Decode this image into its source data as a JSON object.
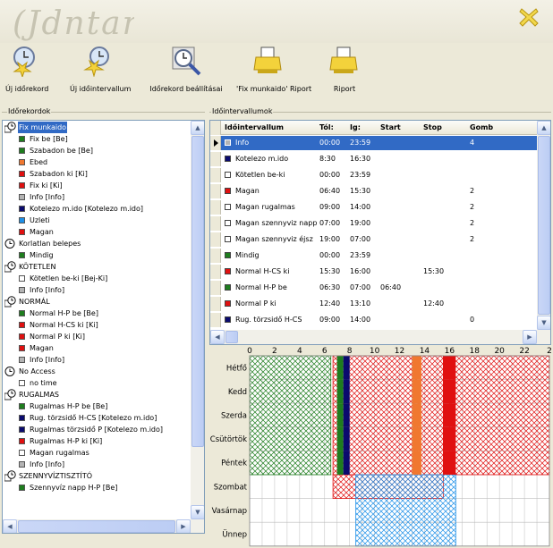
{
  "app": {
    "logo_text": "Idontar"
  },
  "toolbar": [
    {
      "label": "Új időrekord",
      "icon": "clock-star-icon"
    },
    {
      "label": "Új időintervallum",
      "icon": "clock-star-icon"
    },
    {
      "label": "Időrekord beállításai",
      "icon": "clock-magnifier-icon"
    },
    {
      "label": "'Fix munkaido' Riport",
      "icon": "printer-icon"
    },
    {
      "label": "Riport",
      "icon": "printer-icon"
    }
  ],
  "panels": {
    "left_title": "Időrekordok",
    "right_title": "Időintervallumok"
  },
  "colors": {
    "green": "#1e7d1e",
    "red": "#e01010",
    "orange": "#f07830",
    "navy": "#0a0a6e",
    "blue": "#1e90e8",
    "gray": "#b4b4b4",
    "white": "#ffffff",
    "selection": "#316ac5"
  },
  "tree": [
    {
      "type": "group",
      "label": "Fix munkaido",
      "selected": true
    },
    {
      "type": "item",
      "label": "Fix be [Be]",
      "color": "green"
    },
    {
      "type": "item",
      "label": "Szabadon be [Be]",
      "color": "green"
    },
    {
      "type": "item",
      "label": "Ebed",
      "color": "orange"
    },
    {
      "type": "item",
      "label": "Szabadon ki [Ki]",
      "color": "red"
    },
    {
      "type": "item",
      "label": "Fix ki [Ki]",
      "color": "red"
    },
    {
      "type": "item",
      "label": "Info [Info]",
      "color": "gray"
    },
    {
      "type": "item",
      "label": "Kotelezo m.ido [Kotelezo m.ido]",
      "color": "navy"
    },
    {
      "type": "item",
      "label": "Uzleti",
      "color": "blue"
    },
    {
      "type": "item",
      "label": "Magan",
      "color": "red"
    },
    {
      "type": "group2",
      "label": "Korlatlan belepes"
    },
    {
      "type": "item",
      "label": "Mindig",
      "color": "green"
    },
    {
      "type": "group",
      "label": "KÖTETLEN"
    },
    {
      "type": "item",
      "label": "Kötetlen be-ki [Bej-Ki]",
      "color": "white"
    },
    {
      "type": "item",
      "label": "Info [Info]",
      "color": "gray"
    },
    {
      "type": "group",
      "label": "NORMÁL"
    },
    {
      "type": "item",
      "label": "Normal H-P be [Be]",
      "color": "green"
    },
    {
      "type": "item",
      "label": "Normal H-CS ki [Ki]",
      "color": "red"
    },
    {
      "type": "item",
      "label": "Normal P ki [Ki]",
      "color": "red"
    },
    {
      "type": "item",
      "label": "Magan",
      "color": "red"
    },
    {
      "type": "item",
      "label": "Info [Info]",
      "color": "gray"
    },
    {
      "type": "group2",
      "label": "No Access"
    },
    {
      "type": "item",
      "label": "no time",
      "color": "white"
    },
    {
      "type": "group",
      "label": "RUGALMAS"
    },
    {
      "type": "item",
      "label": "Rugalmas H-P be [Be]",
      "color": "green"
    },
    {
      "type": "item",
      "label": "Rug. törzsidő H-CS [Kotelezo m.ido]",
      "color": "navy"
    },
    {
      "type": "item",
      "label": "Rugalmas törzsidő P [Kotelezo m.ido]",
      "color": "navy"
    },
    {
      "type": "item",
      "label": "Rugalmas H-P ki [Ki]",
      "color": "red"
    },
    {
      "type": "item",
      "label": "Magan rugalmas",
      "color": "white"
    },
    {
      "type": "item",
      "label": "Info [Info]",
      "color": "gray"
    },
    {
      "type": "group",
      "label": "SZENNYVÍZTISZTÍTÓ"
    },
    {
      "type": "item",
      "label": "Szennyvíz napp H-P [Be]",
      "color": "green"
    }
  ],
  "grid": {
    "columns": [
      "Időintervallum",
      "Tól:",
      "Ig:",
      "Start",
      "Stop",
      "Gomb"
    ],
    "rows": [
      {
        "name": "Info",
        "color": "gray",
        "from": "00:00",
        "to": "23:59",
        "start": "",
        "stop": "",
        "gomb": "4",
        "selected": true
      },
      {
        "name": "Kotelezo m.ido",
        "color": "navy",
        "from": "8:30",
        "to": "16:30",
        "start": "",
        "stop": "",
        "gomb": ""
      },
      {
        "name": "Kötetlen be-ki",
        "color": "white",
        "from": "00:00",
        "to": "23:59",
        "start": "",
        "stop": "",
        "gomb": ""
      },
      {
        "name": "Magan",
        "color": "red",
        "from": "06:40",
        "to": "15:30",
        "start": "",
        "stop": "",
        "gomb": "2"
      },
      {
        "name": "Magan rugalmas",
        "color": "white",
        "from": "09:00",
        "to": "14:00",
        "start": "",
        "stop": "",
        "gomb": "2"
      },
      {
        "name": "Magan szennyviz napp",
        "color": "white",
        "from": "07:00",
        "to": "19:00",
        "start": "",
        "stop": "",
        "gomb": "2"
      },
      {
        "name": "Magan szennyviz éjsz",
        "color": "white",
        "from": "19:00",
        "to": "07:00",
        "start": "",
        "stop": "",
        "gomb": "2"
      },
      {
        "name": "Mindig",
        "color": "green",
        "from": "00:00",
        "to": "23:59",
        "start": "",
        "stop": "",
        "gomb": ""
      },
      {
        "name": "Normal H-CS ki",
        "color": "red",
        "from": "15:30",
        "to": "16:00",
        "start": "",
        "stop": "15:30",
        "gomb": ""
      },
      {
        "name": "Normal H-P be",
        "color": "green",
        "from": "06:30",
        "to": "07:00",
        "start": "06:40",
        "stop": "",
        "gomb": ""
      },
      {
        "name": "Normal P ki",
        "color": "red",
        "from": "12:40",
        "to": "13:10",
        "start": "",
        "stop": "12:40",
        "gomb": ""
      },
      {
        "name": "Rug. törzsidő H-CS",
        "color": "navy",
        "from": "09:00",
        "to": "14:00",
        "start": "",
        "stop": "",
        "gomb": "0"
      }
    ]
  },
  "chart_data": {
    "type": "heatmap",
    "x_ticks": [
      "0",
      "2",
      "4",
      "6",
      "8",
      "10",
      "12",
      "14",
      "16",
      "18",
      "20",
      "22",
      "2"
    ],
    "xlim": [
      0,
      24
    ],
    "days": [
      "Hétfő",
      "Kedd",
      "Szerda",
      "Csütörtök",
      "Péntek",
      "Szombat",
      "Vasárnap",
      "Ünnep"
    ],
    "hatched_ranges": [
      {
        "days": [
          0,
          1,
          2,
          3,
          4
        ],
        "from": 0,
        "to": 6.5,
        "color": "green"
      },
      {
        "days": [
          0,
          1,
          2,
          3,
          4
        ],
        "from": 6.67,
        "to": 15.5,
        "color": "red"
      },
      {
        "days": [
          0,
          1,
          2,
          3,
          4
        ],
        "from": 16,
        "to": 24,
        "color": "red"
      },
      {
        "days": [
          5
        ],
        "from": 6.67,
        "to": 15.5,
        "color": "red"
      },
      {
        "days": [
          5,
          6,
          7
        ],
        "from": 8.5,
        "to": 16.5,
        "color": "blue"
      }
    ],
    "solid_bars": [
      {
        "days": [
          0,
          1,
          2,
          3,
          4
        ],
        "from": 7,
        "to": 7.5,
        "color": "green"
      },
      {
        "days": [
          0,
          1,
          2,
          3,
          4
        ],
        "from": 7.5,
        "to": 8,
        "color": "navy"
      },
      {
        "days": [
          0,
          1,
          2,
          3,
          4
        ],
        "from": 13,
        "to": 13.75,
        "color": "orange"
      },
      {
        "days": [
          0,
          1,
          2,
          3,
          4
        ],
        "from": 15.5,
        "to": 16,
        "color": "red"
      },
      {
        "days": [
          0,
          1,
          2,
          3,
          4
        ],
        "from": 16,
        "to": 16.5,
        "color": "red"
      }
    ]
  }
}
